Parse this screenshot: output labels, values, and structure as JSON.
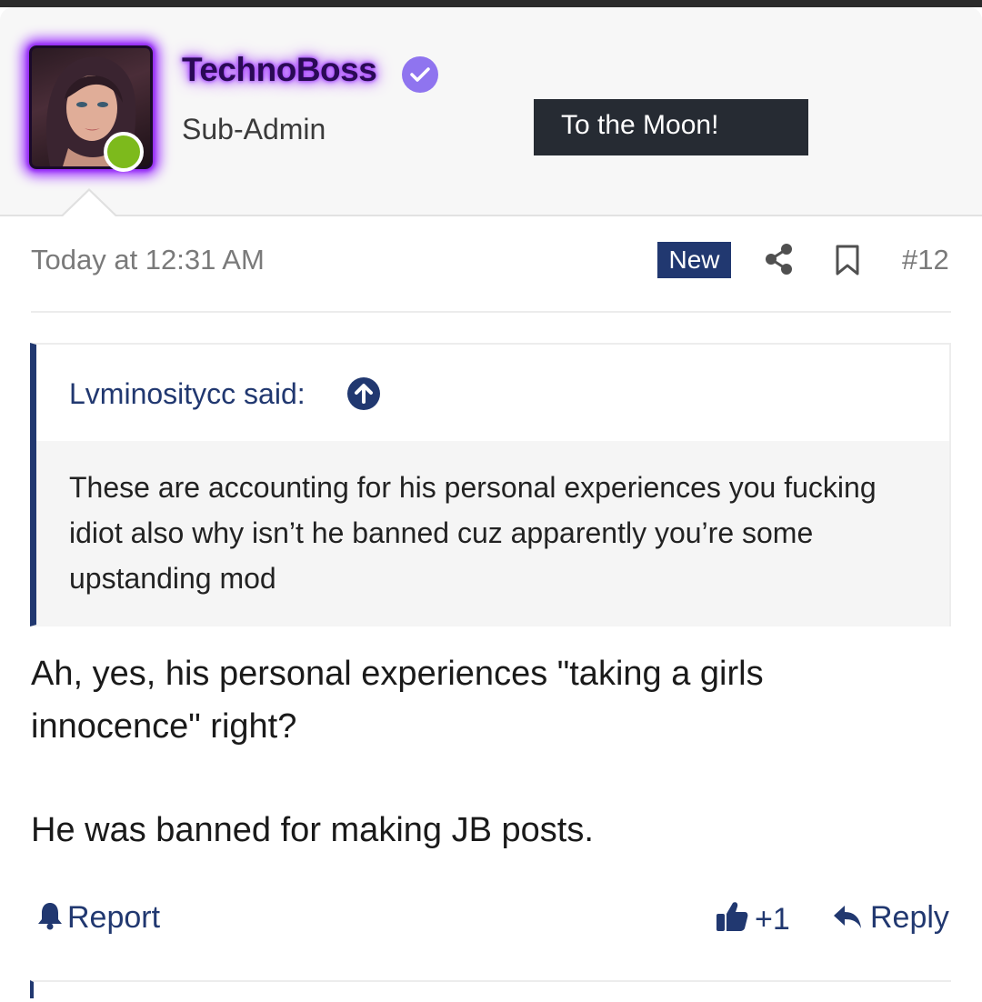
{
  "post": {
    "author": {
      "username": "TechnoBoss",
      "title": "Sub-Admin",
      "banner": "To the Moon!",
      "online": true
    },
    "timestamp": "Today at 12:31 AM",
    "badge": "New",
    "post_number": "#12",
    "quote": {
      "attribution": "Lvminositycc said:",
      "text": "These are accounting for his personal experiences you fucking idiot also why isn’t he banned cuz apparently you’re some upstanding mod"
    },
    "body": {
      "paragraph1": "Ah, yes, his personal experiences \"taking a girls innocence\" right?",
      "paragraph2": "He was banned for making JB posts."
    },
    "actions": {
      "report_label": "Report",
      "like_count": "+1",
      "reply_label": "Reply"
    }
  },
  "colors": {
    "accent": "#213870",
    "username_glow": "#9b2bff",
    "online": "#7dba1c",
    "verified": "#8f74ef",
    "banner_bg": "#262b33"
  },
  "icons": [
    "share-icon",
    "bookmark-icon",
    "arrow-up-icon",
    "bell-icon",
    "thumbs-up-icon",
    "reply-icon",
    "verified-icon"
  ]
}
